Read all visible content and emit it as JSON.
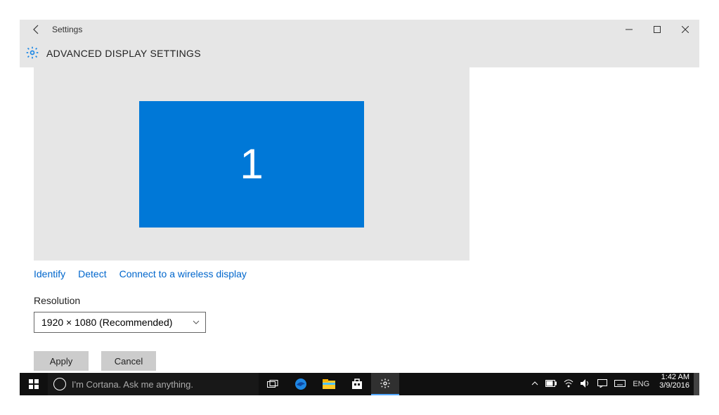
{
  "window": {
    "title": "Settings",
    "header": "ADVANCED DISPLAY SETTINGS"
  },
  "display": {
    "monitor_number": "1",
    "links": {
      "identify": "Identify",
      "detect": "Detect",
      "wireless": "Connect to a wireless display"
    },
    "resolution_label": "Resolution",
    "resolution_value": "1920 × 1080 (Recommended)",
    "buttons": {
      "apply": "Apply",
      "cancel": "Cancel"
    }
  },
  "taskbar": {
    "search_placeholder": "I'm Cortana. Ask me anything.",
    "lang": "ENG",
    "time": "1:42 AM",
    "date": "3/9/2016"
  }
}
